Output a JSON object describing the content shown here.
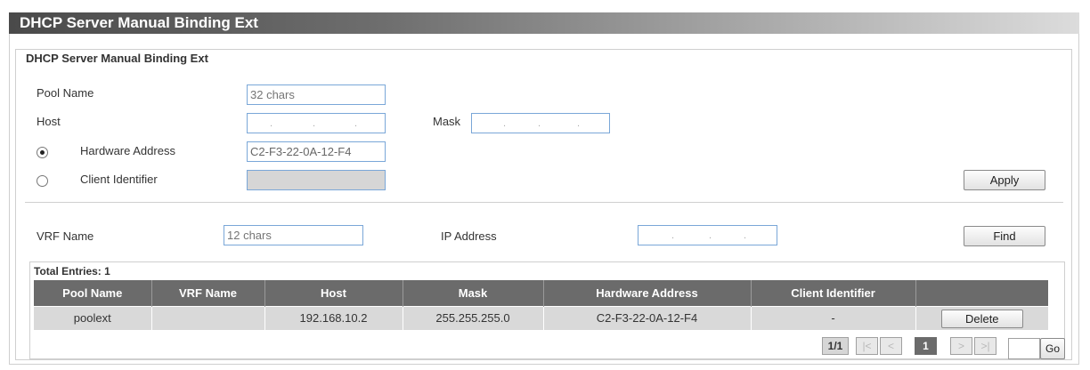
{
  "page": {
    "title": "DHCP Server Manual Binding Ext"
  },
  "form": {
    "legend": "DHCP Server Manual Binding Ext",
    "pool_name_label": "Pool Name",
    "pool_name_placeholder": "32 chars",
    "host_label": "Host",
    "mask_label": "Mask",
    "hardware_address_label": "Hardware Address",
    "hardware_address_value": "C2-F3-22-0A-12-F4",
    "hardware_address_selected": true,
    "client_identifier_label": "Client Identifier",
    "client_identifier_selected": false,
    "apply_label": "Apply"
  },
  "search": {
    "vrf_label": "VRF Name",
    "vrf_placeholder": "12 chars",
    "ip_label": "IP Address",
    "find_label": "Find"
  },
  "table": {
    "total_entries": "Total Entries: 1",
    "headers": [
      "Pool Name",
      "VRF Name",
      "Host",
      "Mask",
      "Hardware Address",
      "Client Identifier",
      ""
    ],
    "rows": [
      {
        "pool_name": "poolext",
        "vrf_name": "",
        "host": "192.168.10.2",
        "mask": "255.255.255.0",
        "hardware_address": "C2-F3-22-0A-12-F4",
        "client_identifier": "-",
        "delete_label": "Delete"
      }
    ]
  },
  "pagination": {
    "page_info": "1/1",
    "first": "|<",
    "prev": "<",
    "current": "1",
    "next": ">",
    "last": ">|",
    "go_label": "Go",
    "go_value": ""
  },
  "colors": {
    "header_bg": "#6b6b6b",
    "row_bg": "#d9d9d9",
    "input_border": "#7aa7d8"
  }
}
